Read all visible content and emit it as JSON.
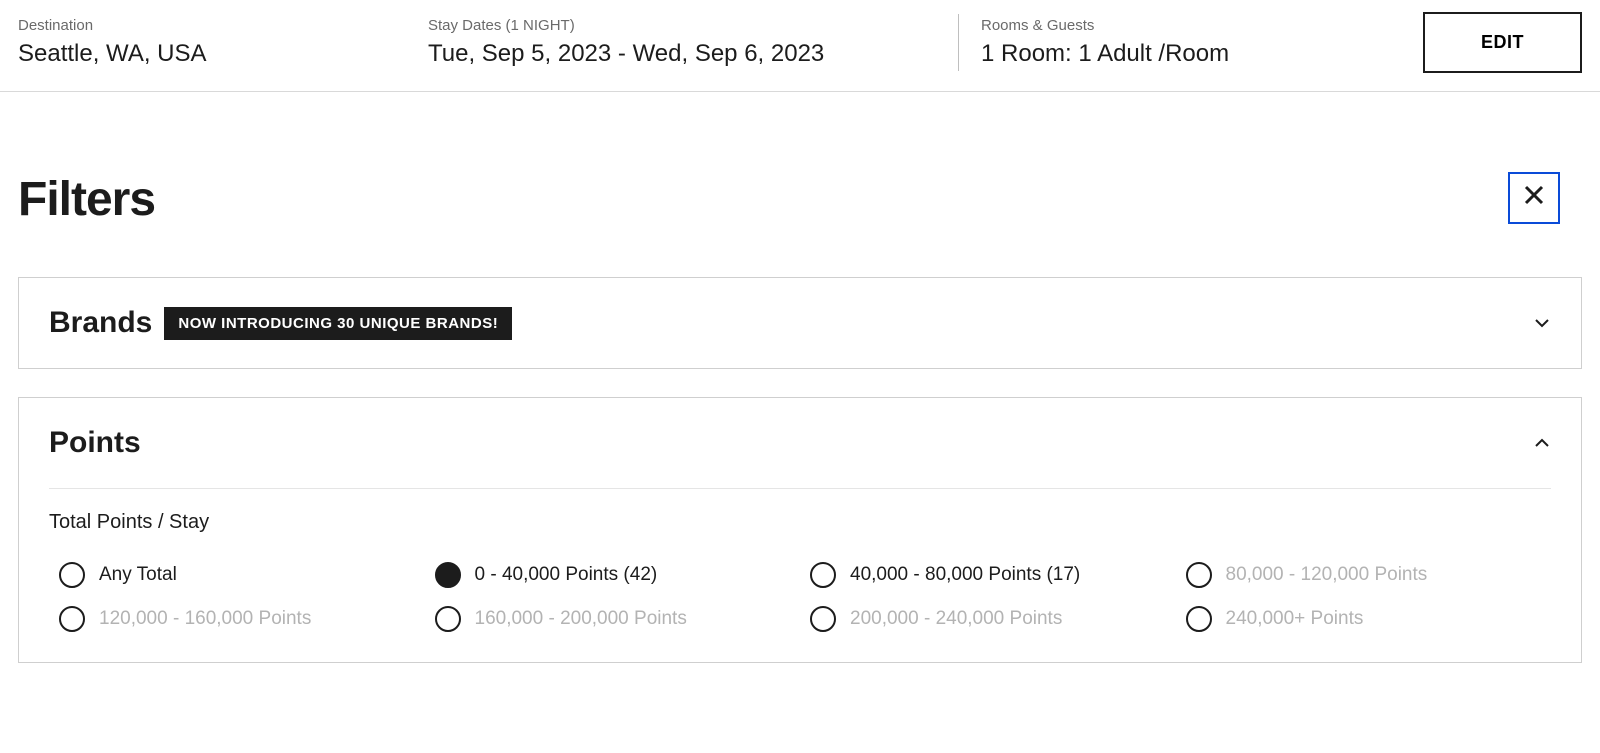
{
  "search": {
    "destination": {
      "label": "Destination",
      "value": "Seattle, WA, USA"
    },
    "dates": {
      "label": "Stay Dates (1 NIGHT)",
      "value": "Tue, Sep 5, 2023 - Wed, Sep 6, 2023"
    },
    "rooms": {
      "label": "Rooms & Guests",
      "value": "1 Room: 1 Adult /Room"
    },
    "edit_label": "EDIT"
  },
  "filters": {
    "title": "Filters",
    "brands": {
      "title": "Brands",
      "badge": "NOW INTRODUCING 30 UNIQUE BRANDS!"
    },
    "points": {
      "title": "Points",
      "subsection": "Total Points / Stay",
      "options": [
        {
          "label": "Any Total",
          "selected": false,
          "disabled": false
        },
        {
          "label": "0 - 40,000 Points (42)",
          "selected": true,
          "disabled": false
        },
        {
          "label": "40,000 - 80,000 Points (17)",
          "selected": false,
          "disabled": false
        },
        {
          "label": "80,000 - 120,000 Points",
          "selected": false,
          "disabled": true
        },
        {
          "label": "120,000 - 160,000 Points",
          "selected": false,
          "disabled": true
        },
        {
          "label": "160,000 - 200,000 Points",
          "selected": false,
          "disabled": true
        },
        {
          "label": "200,000 - 240,000 Points",
          "selected": false,
          "disabled": true
        },
        {
          "label": "240,000+ Points",
          "selected": false,
          "disabled": true
        }
      ]
    }
  }
}
